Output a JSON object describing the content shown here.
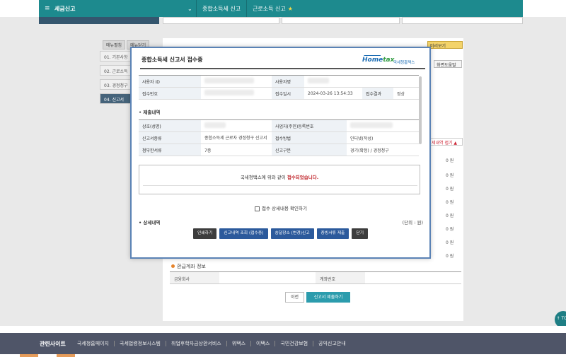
{
  "topbar": {
    "menu_icon": "≡",
    "title": "세금신고",
    "breadcrumbs": [
      "종합소득세 신고",
      "근로소득 신고"
    ],
    "favorite_icon": "★"
  },
  "background": {
    "tabs": [
      "메뉴펼침",
      "메뉴닫기"
    ],
    "side_menu": [
      "01. 기본사항",
      "02. 근로소득",
      "03. 경정청구",
      "04. 신고서"
    ],
    "preview_label": "미리보기",
    "help_label": "화면도움말",
    "detail_toggle": "세내역 접기 ▲",
    "zero_values": [
      "0 원",
      "0 원",
      "0 원",
      "0 원",
      "0 원",
      "0 원",
      "0 원",
      "0 원"
    ],
    "refund_section": "환급계좌 정보",
    "bank_label": "금융회사",
    "account_label": "계좌번호",
    "prev_button": "이전",
    "submit_button": "신고서 제출하기",
    "top_button": "↑ TOP"
  },
  "footer": {
    "title": "관련사이트",
    "links": [
      "국세청홈페이지",
      "국세법령정보시스템",
      "취업후학자금상환서비스",
      "위택스",
      "이택스",
      "국민건강보험",
      "공익신고안내"
    ]
  },
  "modal": {
    "title": "종합소득세 신고서 접수증",
    "logo_main": "Hometax",
    "logo_sub": "국세청홈택스",
    "rows": {
      "user_id_label": "사용자 ID",
      "user_name_label": "사용자명",
      "receipt_no_label": "접수번호",
      "receipt_date_label": "접수일시",
      "receipt_date_value": "2024-03-26 13:54:33",
      "receipt_result_label": "접수결과",
      "receipt_result_value": "정상"
    },
    "submit_section": "제출내역",
    "submit_rows": {
      "name_label": "상호(성명)",
      "bizno_label": "사업자(주민)등록번호",
      "type_label": "신고서종류",
      "type_value": "종합소득세 근로자 경정청구 신고서",
      "method_label": "접수방법",
      "method_value": "인터넷(작성)",
      "attach_label": "첨부한서류",
      "attach_value": "7종",
      "category_label": "신고구분",
      "category_value": "경기(확정) / 경정청구"
    },
    "message_prefix": "국세청택스에 위와 같이 ",
    "message_highlight": "접수되었습니다.",
    "checkbox_label": "접수 상세내용 확인하기",
    "detail_section": "상세내역",
    "unit_label": "(단위 : 원)",
    "buttons": [
      "인쇄하기",
      "신고내역 조회 (접수증)",
      "송달장소 (변경)신고",
      "증빙서류 제출",
      "닫기"
    ]
  },
  "colors": {
    "topbar": "#1d8a8e",
    "modal_border": "#5a82b5",
    "footer": "#4f5568",
    "highlight": "#c1272d",
    "button_blue": "#2c5a9c"
  }
}
